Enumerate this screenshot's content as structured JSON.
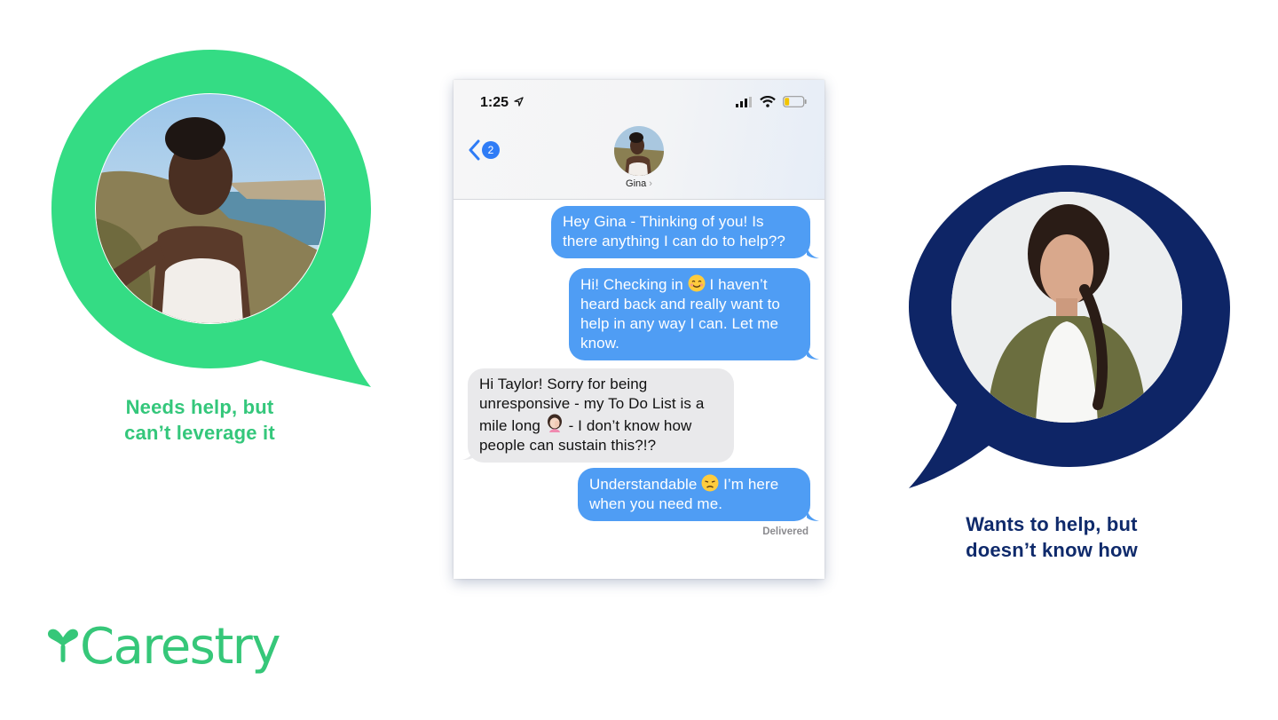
{
  "captions": {
    "left_line1": "Needs help, but",
    "left_line2": "can’t leverage it",
    "right_line1": "Wants to help, but",
    "right_line2": "doesn’t know how"
  },
  "phone": {
    "status_time": "1:25",
    "back_badge": "2",
    "contact_name": "Gina",
    "contact_chevron": "›",
    "messages": [
      {
        "direction": "out",
        "text": "Hey Gina - Thinking of you! Is there anything I can do to help??"
      },
      {
        "direction": "out",
        "text_before": "Hi! Checking in",
        "text_after": " I haven’t heard back and really want to help in any way I can. Let me know."
      },
      {
        "direction": "in",
        "text_before": "Hi Taylor! Sorry for being unresponsive - my To Do List is a mile long",
        "text_after": " - I don’t know how people can sustain this?!?"
      },
      {
        "direction": "out",
        "text_before": "Understandable",
        "text_after": " I’m here when you need me."
      }
    ],
    "delivered": "Delivered"
  },
  "logo": {
    "text": "Carestry"
  },
  "colors": {
    "brand_green": "#34c77b",
    "navy": "#0f2a6b",
    "imessage_blue": "#4f9df4",
    "incoming_gray": "#e9e9eb"
  },
  "icons": [
    "location-arrow-icon",
    "signal-icon",
    "wifi-icon",
    "battery-icon",
    "back-chevron-icon",
    "smile-emoji-icon",
    "woman-facepalm-emoji-icon",
    "sad-emoji-icon",
    "carestry-logo-icon"
  ]
}
